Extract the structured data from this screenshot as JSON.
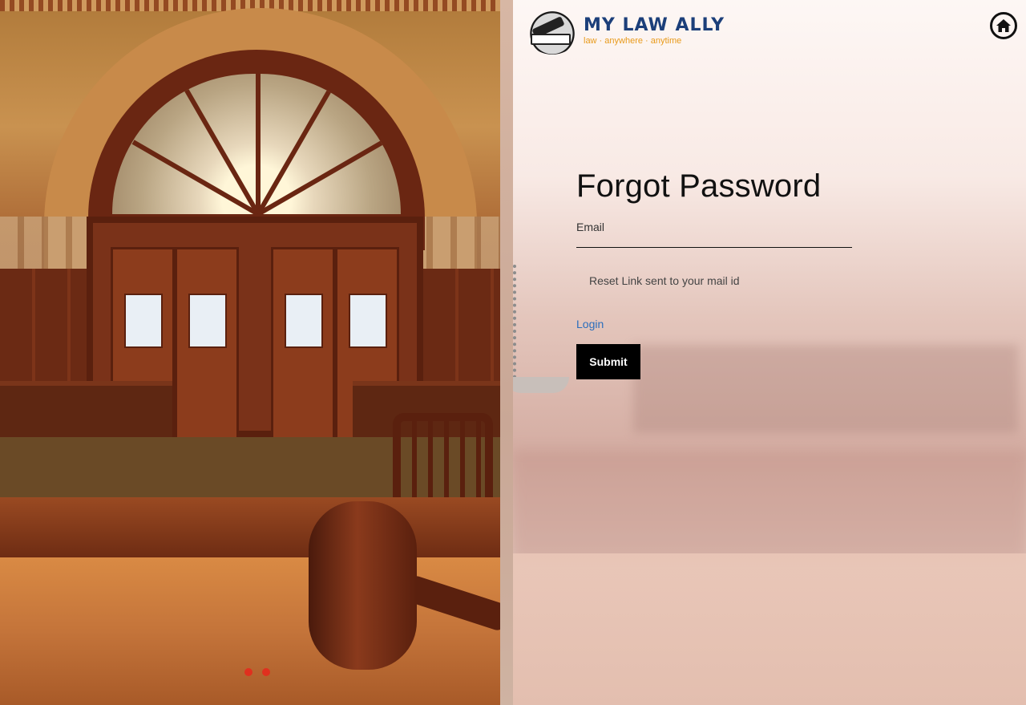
{
  "brand": {
    "name": "MY LAW ALLY",
    "tagline": "law · anywhere · anytime",
    "logo_icon": "gavel-book-emblem-icon"
  },
  "header": {
    "home_icon": "home-icon"
  },
  "form": {
    "title": "Forgot Password",
    "email_label": "Email",
    "email_value": "",
    "status_message": "Reset Link sent to your mail id",
    "login_link": "Login",
    "submit_label": "Submit"
  },
  "carousel": {
    "dot_count": 2,
    "dot_color": "#e0301e"
  },
  "colors": {
    "brand_blue": "#1c3f7a",
    "brand_orange": "#e89a1a",
    "link_blue": "#2a6ebd",
    "button_bg": "#000000"
  }
}
